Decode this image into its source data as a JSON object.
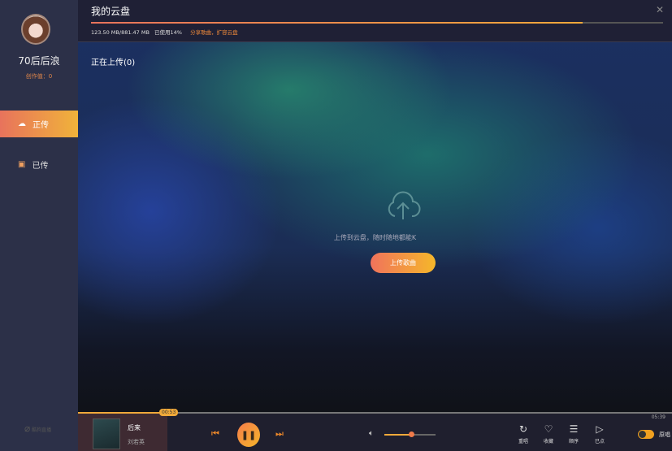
{
  "sidebar": {
    "username": "70后后浪",
    "score": "创作值：0",
    "items": [
      {
        "label": "正传",
        "icon": "cloud-upload-icon"
      },
      {
        "label": "已传",
        "icon": "inbox-icon"
      }
    ],
    "bottom_label": "酷狗直播"
  },
  "header": {
    "title": "我的云盘",
    "usage": "123.50 MB/881.47 MB",
    "used_percent_label": "已使用14%",
    "used_percent": 14,
    "promo_link": "分享歌曲，扩容云盘"
  },
  "content": {
    "section_title": "正在上传(0)",
    "hint": "上传到云盘，随时随地都能K",
    "upload_button": "上传歌曲"
  },
  "player": {
    "current_time": "00:53",
    "total_time": "05:39",
    "progress_fraction": 0.156,
    "song": "后来",
    "artist": "刘若英",
    "volume_fraction": 0.5,
    "tools": [
      {
        "label": "重唱",
        "icon": "replay-icon"
      },
      {
        "label": "收藏",
        "icon": "heart-icon"
      },
      {
        "label": "顺序",
        "icon": "order-icon"
      },
      {
        "label": "已点",
        "icon": "playlist-icon"
      }
    ],
    "toggle_label": "原唱",
    "toggle_on": true
  }
}
